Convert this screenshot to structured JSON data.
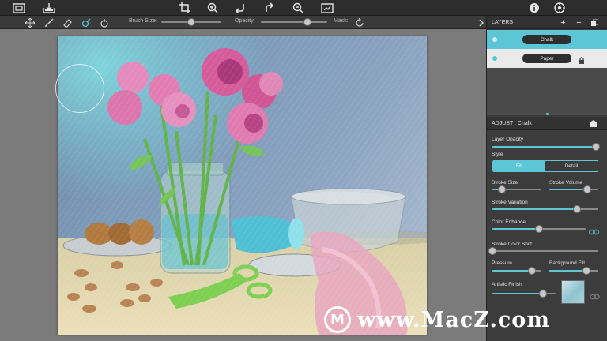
{
  "toolbar": {
    "icons": [
      "frame-icon",
      "open-file-icon",
      "crop-icon",
      "zoom-in-icon",
      "undo-icon",
      "redo-icon",
      "zoom-out-icon",
      "fit-screen-icon",
      "info-icon",
      "settings-icon"
    ]
  },
  "options": {
    "brush_size_label": "Brush Size:",
    "opacity_label": "Opacity:",
    "mask_label": "Mask:",
    "brush_size": 0.5,
    "opacity": 0.7
  },
  "layers": {
    "title": "LAYERS",
    "add_label": "+",
    "remove_label": "−",
    "items": [
      {
        "name": "Chalk",
        "selected": true,
        "locked": false
      },
      {
        "name": "Paper",
        "selected": false,
        "locked": true
      }
    ]
  },
  "adjust": {
    "title": "ADJUST : Chalk",
    "layer_opacity_label": "Layer Opacity",
    "layer_opacity": 0.98,
    "style_label": "Style",
    "style_options": [
      "Fill",
      "Detail"
    ],
    "style_selected": "Fill",
    "stroke_size_label": "Stroke Size",
    "stroke_size": 0.2,
    "stroke_volume_label": "Stroke Volume",
    "stroke_volume": 0.78,
    "stroke_variation_label": "Stroke Variation",
    "stroke_variation": 0.8,
    "color_enhance_label": "Color Enhance",
    "color_enhance": 0.5,
    "stroke_color_shift_label": "Stroke Color Shift",
    "stroke_color_shift": 0.0,
    "pressure_label": "Pressure",
    "pressure": 0.8,
    "background_fill_label": "Background Fill",
    "background_fill": 0.75,
    "artistic_finish_label": "Artistic Finish",
    "artistic_finish": 0.8
  },
  "watermark": {
    "logo": "M",
    "text": "www.MacZ.com"
  },
  "colors": {
    "accent": "#5cc6d6",
    "panel": "#3c3c3c",
    "toolbar": "#2d2d2d"
  }
}
